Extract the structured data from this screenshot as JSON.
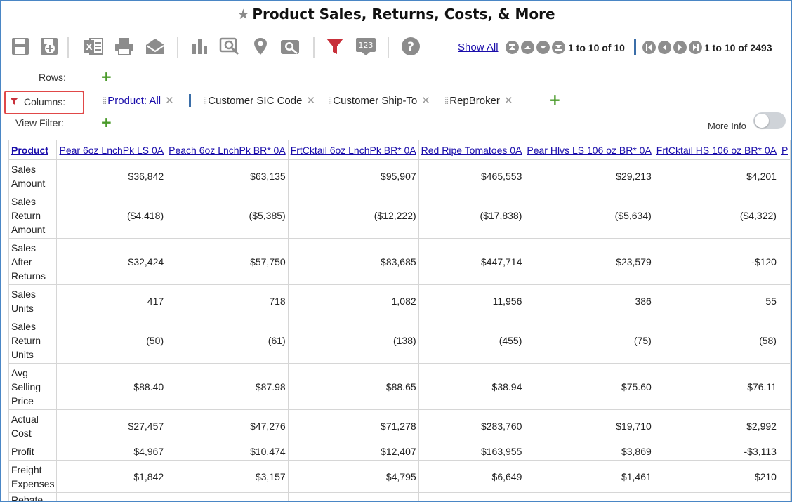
{
  "title": "Product Sales, Returns, Costs, & More",
  "toolbar": {
    "icons": [
      "save-icon",
      "save-as-icon",
      "excel-export-icon",
      "print-icon",
      "email-icon",
      "chart-icon",
      "drilldown-icon",
      "map-pin-icon",
      "search-icon",
      "filter-icon",
      "row-numbers-icon",
      "help-icon"
    ]
  },
  "pager": {
    "show_all": "Show All",
    "col_range": "1 to 10 of 10",
    "row_range": "1 to 10 of 2493"
  },
  "config": {
    "rows_label": "Rows:",
    "columns_label": "Columns:",
    "view_filter_label": "View Filter:",
    "chips": {
      "product": "Product: All",
      "sic": "Customer SIC Code",
      "shipto": "Customer Ship-To",
      "repbroker": "RepBroker"
    },
    "more_info": "More Info"
  },
  "table": {
    "corner": "Product",
    "columns": [
      "Pear 6oz LnchPk LS 0A",
      "Peach 6oz LnchPk BR* 0A",
      "FrtCktail 6oz LnchPk BR* 0A",
      "Red Ripe Tomatoes 0A",
      "Pear Hlvs LS 106 oz BR* 0A",
      "FrtCktail HS 106 oz BR* 0A",
      "P"
    ],
    "rows": [
      {
        "label": "Sales Amount",
        "values": [
          "$36,842",
          "$63,135",
          "$95,907",
          "$465,553",
          "$29,213",
          "$4,201",
          ""
        ]
      },
      {
        "label": "Sales Return Amount",
        "values": [
          "($4,418)",
          "($5,385)",
          "($12,222)",
          "($17,838)",
          "($5,634)",
          "($4,322)",
          ""
        ]
      },
      {
        "label": "Sales After Returns",
        "values": [
          "$32,424",
          "$57,750",
          "$83,685",
          "$447,714",
          "$23,579",
          "-$120",
          ""
        ]
      },
      {
        "label": "Sales Units",
        "values": [
          "417",
          "718",
          "1,082",
          "11,956",
          "386",
          "55",
          ""
        ]
      },
      {
        "label": "Sales Return Units",
        "values": [
          "(50)",
          "(61)",
          "(138)",
          "(455)",
          "(75)",
          "(58)",
          ""
        ]
      },
      {
        "label": "Avg Selling Price",
        "values": [
          "$88.40",
          "$87.98",
          "$88.65",
          "$38.94",
          "$75.60",
          "$76.11",
          ""
        ]
      },
      {
        "label": "Actual Cost",
        "values": [
          "$27,457",
          "$47,276",
          "$71,278",
          "$283,760",
          "$19,710",
          "$2,992",
          ""
        ]
      },
      {
        "label": "Profit",
        "values": [
          "$4,967",
          "$10,474",
          "$12,407",
          "$163,955",
          "$3,869",
          "-$3,113",
          ""
        ]
      },
      {
        "label": "Freight Expenses",
        "values": [
          "$1,842",
          "$3,157",
          "$4,795",
          "$6,649",
          "$1,461",
          "$210",
          ""
        ]
      },
      {
        "label": "Rebate",
        "values": [
          "",
          "",
          "",
          "",
          "",
          "",
          ""
        ]
      }
    ]
  },
  "colors": {
    "accent_blue": "#4a86c5",
    "link": "#1a0dab",
    "filter_red": "#c8303a",
    "add_green": "#4a9a2a",
    "columns_highlight": "#e04848"
  }
}
